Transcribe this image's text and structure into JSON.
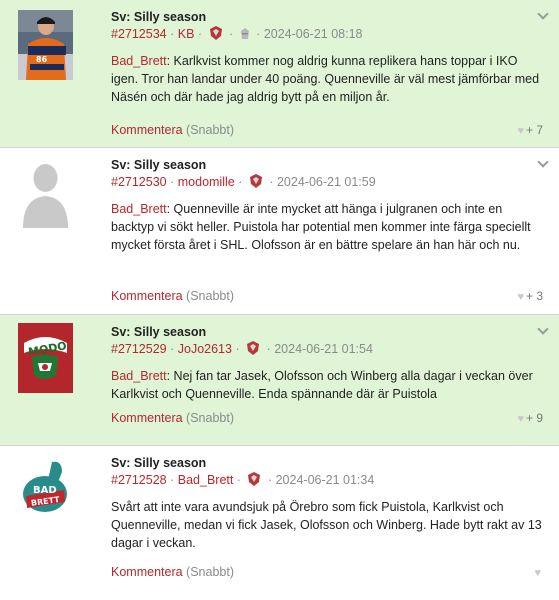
{
  "posts": [
    {
      "title": "Sv: Silly season",
      "post_id": "#2712534",
      "author": "KB",
      "date": "2024-06-21 08:18",
      "highlighted": true,
      "avatar": "player-photo",
      "text_author": "Bad_Brett",
      "text": "Karlkvist kommer nog aldrig kunna replikera hans toppar i IKO igen. Tror han landar under 40 poäng. Quenneville är väl mest jämförbar med Näsén och där hade jag aldrig bytt på en miljon år.",
      "comment_label": "Kommentera",
      "quick_label": "(Snabbt)",
      "likes": "+ 7"
    },
    {
      "title": "Sv: Silly season",
      "post_id": "#2712530",
      "author": "modomille",
      "date": "2024-06-21 01:59",
      "highlighted": false,
      "avatar": "default-user-silhouette",
      "text_author": "Bad_Brett",
      "text": "Quenneville är inte mycket att hänga i julgranen och inte en backtyp vi sökt heller. Puistola har potential men kommer inte färga speciellt mycket första året i SHL. Olofsson är en bättre spelare än han här och nu.",
      "comment_label": "Kommentera",
      "quick_label": "(Snabbt)",
      "likes": "+ 3"
    },
    {
      "title": "Sv: Silly season",
      "post_id": "#2712529",
      "author": "JoJo2613",
      "date": "2024-06-21 01:54",
      "highlighted": true,
      "avatar": "modo-logo",
      "avatar_text": "MODO",
      "text_author": "Bad_Brett",
      "text": "Nej fan tar Jasek, Olofsson och Winberg alla dagar i veckan över Karlkvist och Quenneville. Enda spännande där är Puistola",
      "comment_label": "Kommentera",
      "quick_label": "(Snabbt)",
      "likes": "+ 9"
    },
    {
      "title": "Sv: Silly season",
      "post_id": "#2712528",
      "author": "Bad_Brett",
      "date": "2024-06-21 01:34",
      "highlighted": false,
      "avatar": "bad-brett-badge",
      "avatar_text_1": "BAD",
      "avatar_text_2": "BRETT",
      "text_author": "",
      "text": "Svårt att inte vara avundsjuk på Örebro som fick Puistola, Karlkvist och Quenneville, medan vi fick Jasek, Olofsson och Winberg. Hade bytt rakt av 13 dagar i veckan.",
      "comment_label": "Kommentera",
      "quick_label": "(Snabbt)",
      "likes": ""
    }
  ],
  "colors": {
    "highlight_bg": "#dff5d6",
    "link_red": "#b5282e",
    "muted_gray": "#8a8a8a",
    "modo_red": "#c0262e",
    "badge_teal": "#2a8c8a"
  }
}
